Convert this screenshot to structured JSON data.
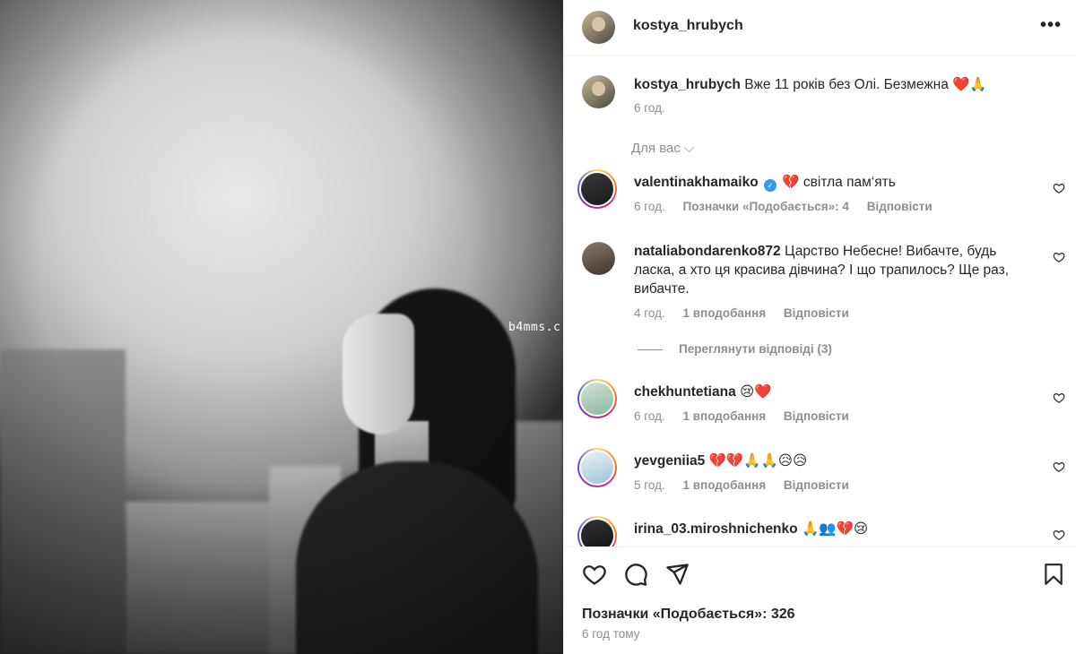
{
  "photo": {
    "watermark": "b4mms.c"
  },
  "post": {
    "username": "kostya_hrubych",
    "caption_user": "kostya_hrubych",
    "caption_text": "Вже 11 років без Олі. Безмежна ❤️🙏",
    "caption_time": "6 год.",
    "for_you": "Для вас ⌵"
  },
  "comments": [
    {
      "user": "valentinakhamaiko",
      "verified": true,
      "text": "💔 світла пам‘ять",
      "time": "6 год.",
      "likes": "Позначки «Подобається»: 4",
      "reply": "Відповісти"
    },
    {
      "user": "nataliabondarenko872",
      "verified": false,
      "text": "Царство Небесне! Вибачте, будь ласка, а хто ця красива дівчина? І що трапилось? Ще раз, вибачте.",
      "time": "4 год.",
      "likes": "1 вподобання",
      "reply": "Відповісти",
      "view_replies": "Переглянути відповіді (3)"
    },
    {
      "user": "chekhuntetiana",
      "verified": false,
      "text": "😢❤️",
      "time": "6 год.",
      "likes": "1 вподобання",
      "reply": "Відповісти"
    },
    {
      "user": "yevgeniia5",
      "verified": false,
      "text": "💔💔🙏🙏😥😥",
      "time": "5 год.",
      "likes": "1 вподобання",
      "reply": "Відповісти"
    },
    {
      "user": "irina_03.miroshnichenko",
      "verified": false,
      "text": "🙏👥💔😢",
      "time": "",
      "likes": "",
      "reply": ""
    }
  ],
  "footer": {
    "likes": "Позначки «Подобається»: 326",
    "time": "6 год тому"
  },
  "icons": [
    "more-icon",
    "like-icon",
    "comment-icon",
    "share-icon",
    "save-icon",
    "comment-heart-icon",
    "verified-badge-icon"
  ]
}
